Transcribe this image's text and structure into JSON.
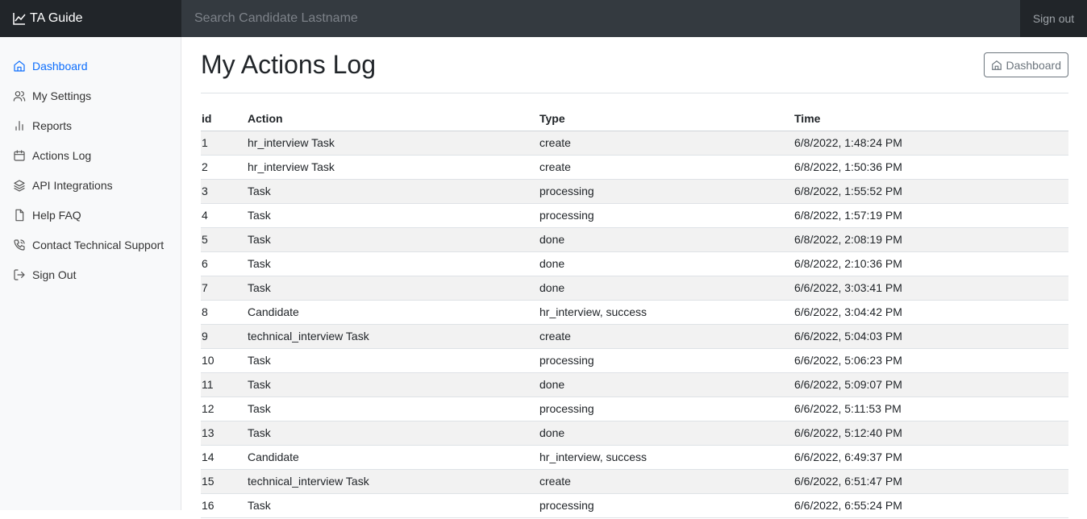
{
  "topbar": {
    "brand": "TA Guide",
    "brand_icon": "graph-up-icon",
    "search_placeholder": "Search Candidate Lastname",
    "signout_label": "Sign out"
  },
  "sidebar": {
    "items": [
      {
        "label": "Dashboard",
        "icon": "home-icon",
        "active": true
      },
      {
        "label": "My Settings",
        "icon": "users-icon"
      },
      {
        "label": "Reports",
        "icon": "bar-chart-icon"
      },
      {
        "label": "Actions Log",
        "icon": "calendar-icon"
      },
      {
        "label": "API Integrations",
        "icon": "layers-icon"
      },
      {
        "label": "Help FAQ",
        "icon": "file-icon"
      },
      {
        "label": "Contact Technical Support",
        "icon": "phone-icon"
      },
      {
        "label": "Sign Out",
        "icon": "log-out-icon"
      }
    ]
  },
  "main": {
    "title": "My Actions Log",
    "dashboard_button": "Dashboard"
  },
  "table": {
    "headers": [
      "id",
      "Action",
      "Type",
      "Time"
    ],
    "rows": [
      [
        "1",
        "hr_interview Task",
        "create",
        "6/8/2022, 1:48:24 PM"
      ],
      [
        "2",
        "hr_interview Task",
        "create",
        "6/8/2022, 1:50:36 PM"
      ],
      [
        "3",
        "Task",
        "processing",
        "6/8/2022, 1:55:52 PM"
      ],
      [
        "4",
        "Task",
        "processing",
        "6/8/2022, 1:57:19 PM"
      ],
      [
        "5",
        "Task",
        "done",
        "6/8/2022, 2:08:19 PM"
      ],
      [
        "6",
        "Task",
        "done",
        "6/8/2022, 2:10:36 PM"
      ],
      [
        "7",
        "Task",
        "done",
        "6/6/2022, 3:03:41 PM"
      ],
      [
        "8",
        "Candidate",
        "hr_interview, success",
        "6/6/2022, 3:04:42 PM"
      ],
      [
        "9",
        "technical_interview Task",
        "create",
        "6/6/2022, 5:04:03 PM"
      ],
      [
        "10",
        "Task",
        "processing",
        "6/6/2022, 5:06:23 PM"
      ],
      [
        "11",
        "Task",
        "done",
        "6/6/2022, 5:09:07 PM"
      ],
      [
        "12",
        "Task",
        "processing",
        "6/6/2022, 5:11:53 PM"
      ],
      [
        "13",
        "Task",
        "done",
        "6/6/2022, 5:12:40 PM"
      ],
      [
        "14",
        "Candidate",
        "hr_interview, success",
        "6/6/2022, 6:49:37 PM"
      ],
      [
        "15",
        "technical_interview Task",
        "create",
        "6/6/2022, 6:51:47 PM"
      ],
      [
        "16",
        "Task",
        "processing",
        "6/6/2022, 6:55:24 PM"
      ]
    ]
  }
}
